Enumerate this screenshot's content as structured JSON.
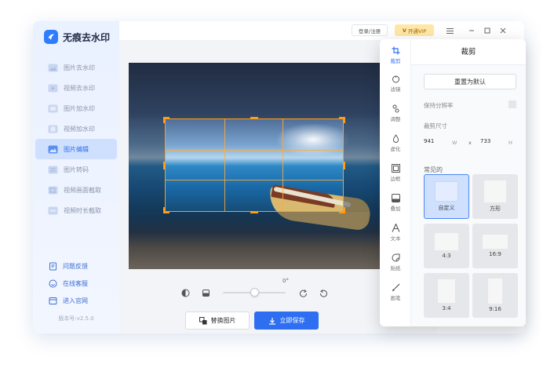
{
  "app": {
    "name": "无痕去水印",
    "version": "版本号:v2.5.0"
  },
  "sidebar": {
    "items": [
      {
        "label": "图片去水印",
        "icon": "image-icon"
      },
      {
        "label": "视频去水印",
        "icon": "video-icon"
      },
      {
        "label": "图片加水印",
        "icon": "image-add-icon"
      },
      {
        "label": "视频加水印",
        "icon": "video-add-icon"
      },
      {
        "label": "图片编辑",
        "icon": "image-edit-icon",
        "active": true
      },
      {
        "label": "图片转码",
        "icon": "image-convert-icon"
      },
      {
        "label": "视频画面截取",
        "icon": "video-crop-icon"
      },
      {
        "label": "视频时长截取",
        "icon": "video-trim-icon"
      }
    ],
    "bottom": [
      {
        "label": "问题反馈",
        "icon": "feedback-icon"
      },
      {
        "label": "在线客服",
        "icon": "headset-icon"
      },
      {
        "label": "进入官网",
        "icon": "website-icon"
      }
    ]
  },
  "titlebar": {
    "login": "登录/注册",
    "vip": "开通VIP"
  },
  "editor": {
    "rotation": "0°",
    "rotation_fraction": 0.5,
    "replace_button": "替换图片",
    "save_button": "立即保存"
  },
  "tools": [
    {
      "label": "裁剪",
      "icon": "crop-icon",
      "active": true
    },
    {
      "label": "滤镜",
      "icon": "filter-icon"
    },
    {
      "label": "调整",
      "icon": "adjust-icon"
    },
    {
      "label": "虚化",
      "icon": "blur-icon"
    },
    {
      "label": "边框",
      "icon": "frame-icon"
    },
    {
      "label": "叠加",
      "icon": "overlay-icon"
    },
    {
      "label": "文本",
      "icon": "text-icon"
    },
    {
      "label": "贴纸",
      "icon": "sticker-icon"
    },
    {
      "label": "画笔",
      "icon": "brush-icon"
    }
  ],
  "crop": {
    "title": "裁剪",
    "reset": "重置为默认",
    "keep_ratio": "保持分辨率",
    "size_label": "裁剪尺寸",
    "width": "941",
    "width_unit": "W",
    "separator": "x",
    "height": "733",
    "height_unit": "H",
    "common_label": "常见的",
    "ratios": [
      {
        "label": "自定义",
        "selected": true
      },
      {
        "label": "方形"
      },
      {
        "label": "4:3"
      },
      {
        "label": "16:9"
      },
      {
        "label": "3:4"
      },
      {
        "label": "9:16"
      }
    ]
  },
  "colors": {
    "accent": "#2e6ff2",
    "crop_frame": "#ff9c1a",
    "vip_bg": "#ffe7a8"
  }
}
